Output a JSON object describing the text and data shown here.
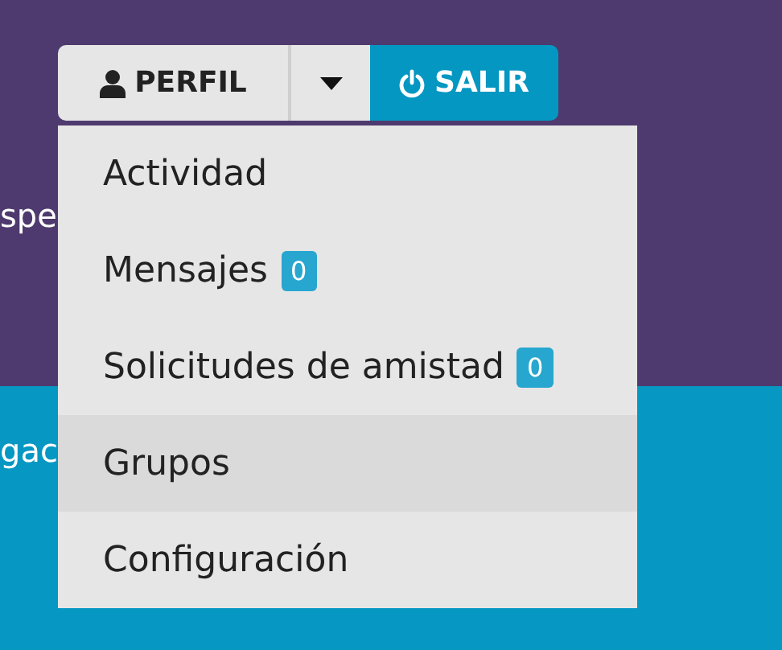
{
  "top_band": {
    "text": "spe"
  },
  "bottom_band": {
    "text": "gac"
  },
  "profile_button": {
    "label": "PERFIL"
  },
  "dropdown_toggle": {
    "expanded": true
  },
  "logout_button": {
    "label": "SALIR"
  },
  "menu_items": [
    {
      "label": "Actividad",
      "selected": false
    },
    {
      "label": "Mensajes",
      "badge": "0",
      "selected": false
    },
    {
      "label": "Solicitudes de amistad",
      "badge": "0",
      "selected": false
    },
    {
      "label": "Grupos",
      "selected": true
    },
    {
      "label": "Configuración",
      "selected": false
    }
  ]
}
